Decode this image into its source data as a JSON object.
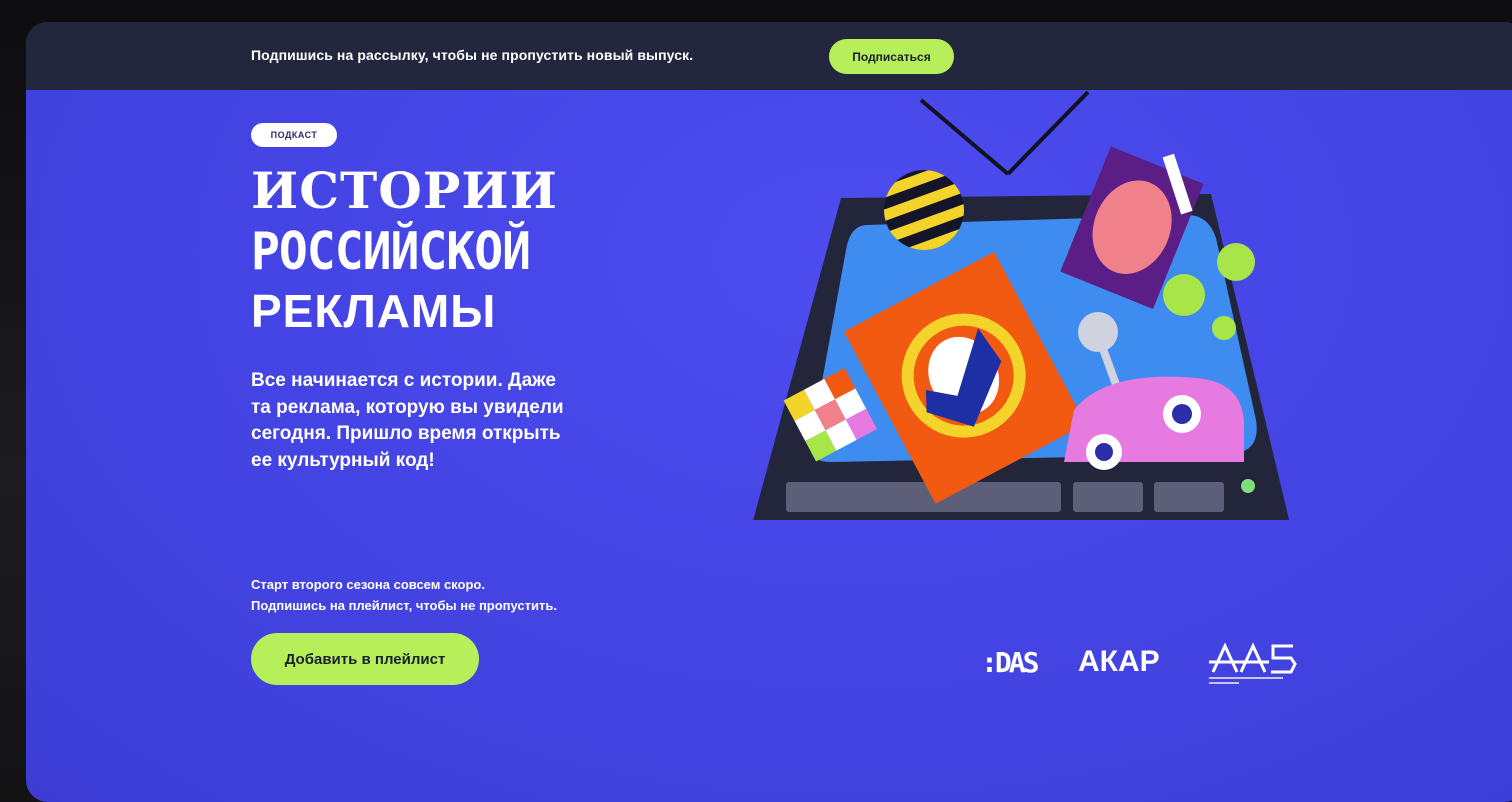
{
  "banner": {
    "text": "Подпишись на рассылку, чтобы не пропустить новый выпуск.",
    "button_label": "Подписаться"
  },
  "hero": {
    "badge": "ПОДКАСТ",
    "title_lines": [
      "ИСТОРИИ",
      "РОССИЙСКОЙ",
      "РЕКЛАМЫ"
    ],
    "description_lines": [
      "Все начинается с истории. Даже",
      "та реклама, которую вы увидели",
      "сегодня. Пришло время открыть",
      "ее культурный код!"
    ],
    "season_lines": [
      "Старт второго сезона совсем скоро.",
      "Подпишись на плейлист, чтобы не пропустить."
    ],
    "playlist_button_label": "Добавить в плейлист"
  },
  "partners": {
    "logo_1": ":DAS",
    "logo_2": "АКАР",
    "logo_3": "AAB"
  },
  "colors": {
    "accent_green": "#b7ef5b",
    "hero_blue": "#4545e6",
    "topbar_dark": "#22273d"
  },
  "icons": [
    "retro-tv-illustration",
    "das-logo",
    "akap-logo",
    "aab-logo"
  ]
}
